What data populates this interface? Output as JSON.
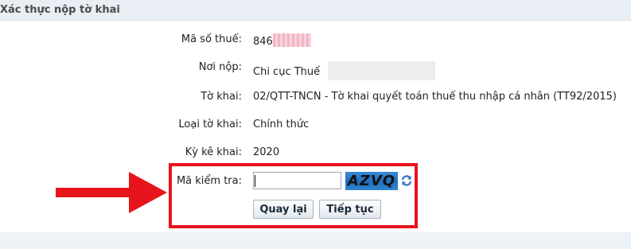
{
  "header": {
    "title": "Xác thực nộp tờ khai"
  },
  "fields": [
    {
      "label": "Mã số thuế:",
      "value": "846"
    },
    {
      "label": "Nơi nộp:",
      "value": "Chi cục Thuế"
    },
    {
      "label": "Tờ khai:",
      "value": "02/QTT-TNCN - Tờ khai quyết toán thuế thu nhập cá nhân (TT92/2015)"
    },
    {
      "label": "Loại tờ khai:",
      "value": "Chính thức"
    },
    {
      "label": "Kỳ kê khai:",
      "value": "2020"
    }
  ],
  "captcha": {
    "label": "Mã kiểm tra:",
    "input_value": "",
    "code": "AZVQ",
    "refresh_icon": "refresh-icon"
  },
  "buttons": {
    "back": "Quay lại",
    "continue": "Tiếp tục"
  },
  "colors": {
    "highlight": "#e8141c",
    "arrow": "#e8141c",
    "captcha_bg": "#2a7bcc"
  }
}
